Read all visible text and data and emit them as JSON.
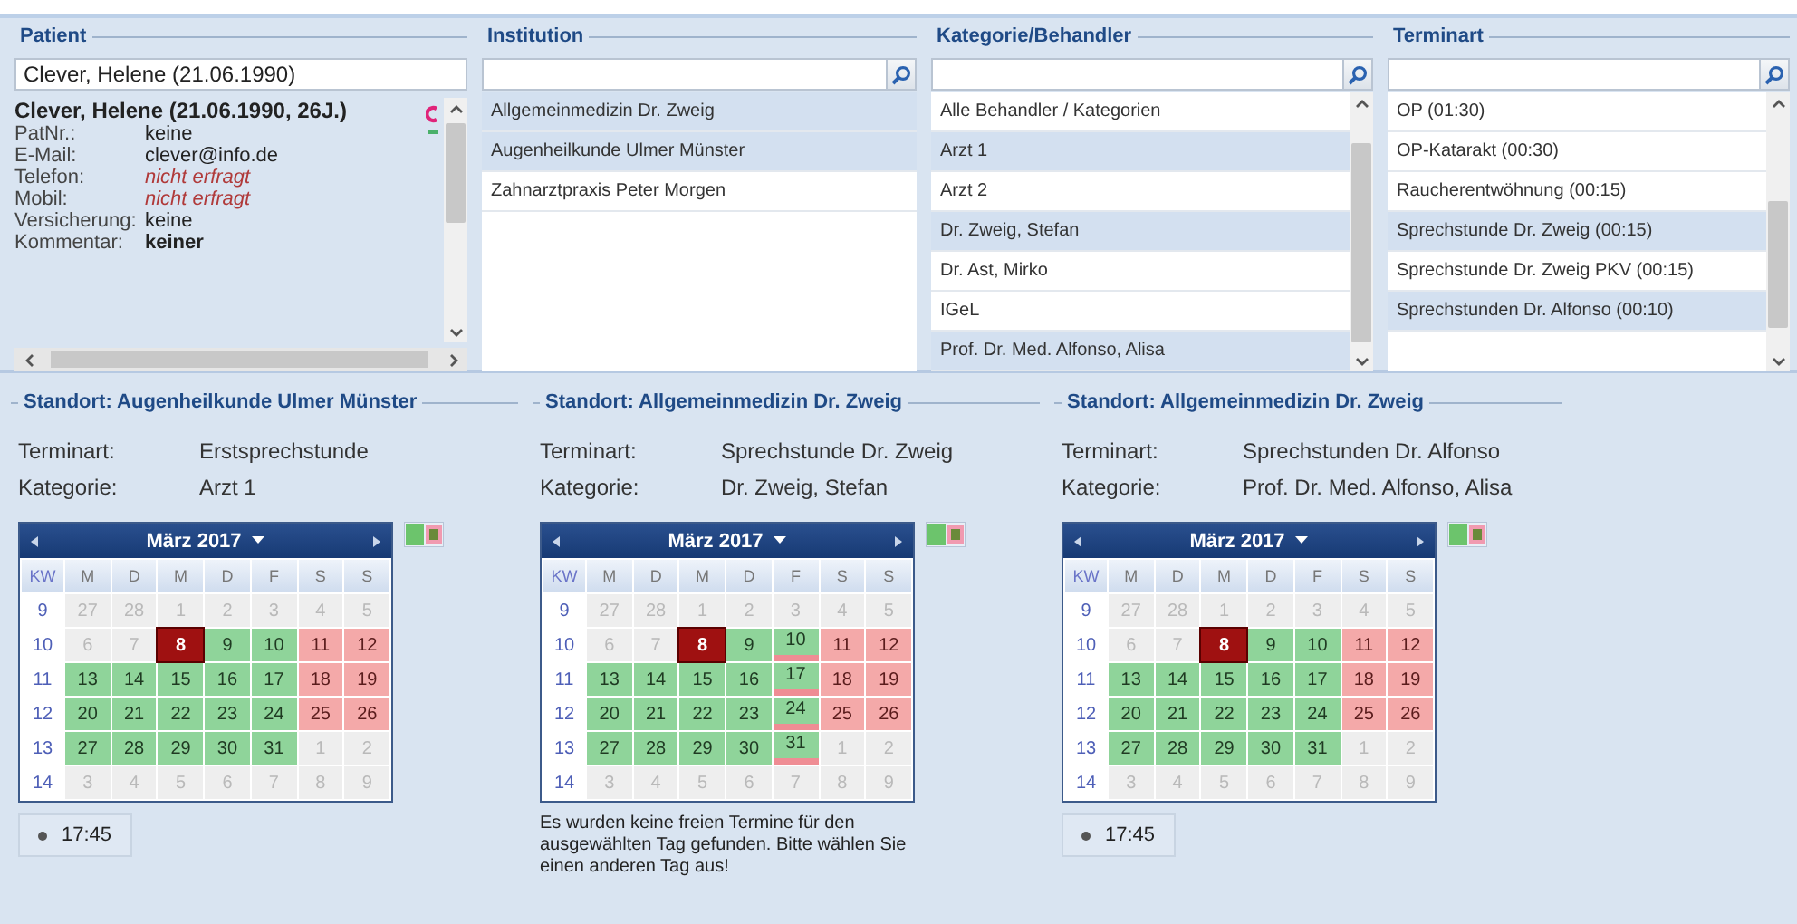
{
  "patient": {
    "title": "Patient",
    "search_value": "Clever, Helene (21.06.1990)",
    "name": "Clever, Helene (21.06.1990, 26J.)",
    "fields": [
      {
        "label": "PatNr.:",
        "value": "keine",
        "kind": "plain"
      },
      {
        "label": "E-Mail:",
        "value": "clever@info.de",
        "kind": "plain"
      },
      {
        "label": "Telefon:",
        "value": "nicht erfragt",
        "kind": "missing"
      },
      {
        "label": "Mobil:",
        "value": "nicht erfragt",
        "kind": "missing"
      },
      {
        "label": "Versicherung:",
        "value": "keine",
        "kind": "plain"
      },
      {
        "label": "Kommentar:",
        "value": "keiner",
        "kind": "bold"
      }
    ]
  },
  "institution": {
    "title": "Institution",
    "items": [
      {
        "label": "Allgemeinmedizin Dr. Zweig",
        "selected": true
      },
      {
        "label": "Augenheilkunde Ulmer Münster",
        "selected": true
      },
      {
        "label": "Zahnarztpraxis Peter Morgen",
        "selected": false
      }
    ]
  },
  "category": {
    "title": "Kategorie/Behandler",
    "items": [
      {
        "label": "Alle Behandler / Kategorien",
        "selected": false
      },
      {
        "label": "Arzt 1",
        "selected": true
      },
      {
        "label": "Arzt 2",
        "selected": false
      },
      {
        "label": "Dr. Zweig, Stefan",
        "selected": true
      },
      {
        "label": "Dr. Ast, Mirko",
        "selected": false
      },
      {
        "label": "IGeL",
        "selected": false
      },
      {
        "label": "Prof. Dr. Med. Alfonso, Alisa",
        "selected": true
      }
    ]
  },
  "appointment_type": {
    "title": "Terminart",
    "items": [
      {
        "label": "OP (01:30)",
        "selected": false
      },
      {
        "label": "OP-Katarakt (00:30)",
        "selected": false
      },
      {
        "label": "Raucherentwöhnung (00:15)",
        "selected": false
      },
      {
        "label": "Sprechstunde Dr. Zweig (00:15)",
        "selected": true
      },
      {
        "label": "Sprechstunde Dr. Zweig PKV (00:15)",
        "selected": false
      },
      {
        "label": "Sprechstunden Dr. Alfonso (00:10)",
        "selected": true
      }
    ]
  },
  "locations": [
    {
      "title": "Standort: Augenheilkunde Ulmer Münster",
      "terminart_label": "Terminart:",
      "terminart": "Erstsprechstunde",
      "kategorie_label": "Kategorie:",
      "kategorie": "Arzt 1",
      "calendar": {
        "month": "März 2017",
        "headers": [
          "KW",
          "M",
          "D",
          "M",
          "D",
          "F",
          "S",
          "S"
        ],
        "weeks": [
          {
            "kw": "9",
            "days": [
              {
                "d": "27",
                "kind": "other"
              },
              {
                "d": "28",
                "kind": "other"
              },
              {
                "d": "1",
                "kind": "other"
              },
              {
                "d": "2",
                "kind": "other"
              },
              {
                "d": "3",
                "kind": "other"
              },
              {
                "d": "4",
                "kind": "other"
              },
              {
                "d": "5",
                "kind": "other"
              }
            ]
          },
          {
            "kw": "10",
            "days": [
              {
                "d": "6",
                "kind": "other"
              },
              {
                "d": "7",
                "kind": "other"
              },
              {
                "d": "8",
                "kind": "selected"
              },
              {
                "d": "9",
                "kind": "free"
              },
              {
                "d": "10",
                "kind": "free"
              },
              {
                "d": "11",
                "kind": "weekend"
              },
              {
                "d": "12",
                "kind": "weekend"
              }
            ]
          },
          {
            "kw": "11",
            "days": [
              {
                "d": "13",
                "kind": "free"
              },
              {
                "d": "14",
                "kind": "free"
              },
              {
                "d": "15",
                "kind": "free"
              },
              {
                "d": "16",
                "kind": "free"
              },
              {
                "d": "17",
                "kind": "free"
              },
              {
                "d": "18",
                "kind": "weekend"
              },
              {
                "d": "19",
                "kind": "weekend"
              }
            ]
          },
          {
            "kw": "12",
            "days": [
              {
                "d": "20",
                "kind": "free"
              },
              {
                "d": "21",
                "kind": "free"
              },
              {
                "d": "22",
                "kind": "free"
              },
              {
                "d": "23",
                "kind": "free"
              },
              {
                "d": "24",
                "kind": "free"
              },
              {
                "d": "25",
                "kind": "weekend"
              },
              {
                "d": "26",
                "kind": "weekend"
              }
            ]
          },
          {
            "kw": "13",
            "days": [
              {
                "d": "27",
                "kind": "free"
              },
              {
                "d": "28",
                "kind": "free"
              },
              {
                "d": "29",
                "kind": "free"
              },
              {
                "d": "30",
                "kind": "free"
              },
              {
                "d": "31",
                "kind": "free"
              },
              {
                "d": "1",
                "kind": "other"
              },
              {
                "d": "2",
                "kind": "other"
              }
            ]
          },
          {
            "kw": "14",
            "days": [
              {
                "d": "3",
                "kind": "other"
              },
              {
                "d": "4",
                "kind": "other"
              },
              {
                "d": "5",
                "kind": "other"
              },
              {
                "d": "6",
                "kind": "other"
              },
              {
                "d": "7",
                "kind": "other"
              },
              {
                "d": "8",
                "kind": "other"
              },
              {
                "d": "9",
                "kind": "other"
              }
            ]
          }
        ]
      },
      "times": [
        "17:45"
      ]
    },
    {
      "title": "Standort: Allgemeinmedizin Dr. Zweig",
      "terminart_label": "Terminart:",
      "terminart": "Sprechstunde Dr. Zweig",
      "kategorie_label": "Kategorie:",
      "kategorie": "Dr.  Zweig, Stefan",
      "calendar": {
        "month": "März 2017",
        "headers": [
          "KW",
          "M",
          "D",
          "M",
          "D",
          "F",
          "S",
          "S"
        ],
        "weeks": [
          {
            "kw": "9",
            "days": [
              {
                "d": "27",
                "kind": "other"
              },
              {
                "d": "28",
                "kind": "other"
              },
              {
                "d": "1",
                "kind": "other"
              },
              {
                "d": "2",
                "kind": "other"
              },
              {
                "d": "3",
                "kind": "other"
              },
              {
                "d": "4",
                "kind": "other"
              },
              {
                "d": "5",
                "kind": "other"
              }
            ]
          },
          {
            "kw": "10",
            "days": [
              {
                "d": "6",
                "kind": "other"
              },
              {
                "d": "7",
                "kind": "other"
              },
              {
                "d": "8",
                "kind": "selected"
              },
              {
                "d": "9",
                "kind": "free"
              },
              {
                "d": "10",
                "kind": "partial"
              },
              {
                "d": "11",
                "kind": "weekend"
              },
              {
                "d": "12",
                "kind": "weekend"
              }
            ]
          },
          {
            "kw": "11",
            "days": [
              {
                "d": "13",
                "kind": "free"
              },
              {
                "d": "14",
                "kind": "free"
              },
              {
                "d": "15",
                "kind": "free"
              },
              {
                "d": "16",
                "kind": "free"
              },
              {
                "d": "17",
                "kind": "partial"
              },
              {
                "d": "18",
                "kind": "weekend"
              },
              {
                "d": "19",
                "kind": "weekend"
              }
            ]
          },
          {
            "kw": "12",
            "days": [
              {
                "d": "20",
                "kind": "free"
              },
              {
                "d": "21",
                "kind": "free"
              },
              {
                "d": "22",
                "kind": "free"
              },
              {
                "d": "23",
                "kind": "free"
              },
              {
                "d": "24",
                "kind": "partial"
              },
              {
                "d": "25",
                "kind": "weekend"
              },
              {
                "d": "26",
                "kind": "weekend"
              }
            ]
          },
          {
            "kw": "13",
            "days": [
              {
                "d": "27",
                "kind": "free"
              },
              {
                "d": "28",
                "kind": "free"
              },
              {
                "d": "29",
                "kind": "free"
              },
              {
                "d": "30",
                "kind": "free"
              },
              {
                "d": "31",
                "kind": "partial"
              },
              {
                "d": "1",
                "kind": "other"
              },
              {
                "d": "2",
                "kind": "other"
              }
            ]
          },
          {
            "kw": "14",
            "days": [
              {
                "d": "3",
                "kind": "other"
              },
              {
                "d": "4",
                "kind": "other"
              },
              {
                "d": "5",
                "kind": "other"
              },
              {
                "d": "6",
                "kind": "other"
              },
              {
                "d": "7",
                "kind": "other"
              },
              {
                "d": "8",
                "kind": "other"
              },
              {
                "d": "9",
                "kind": "other"
              }
            ]
          }
        ]
      },
      "message": "Es wurden keine freien Termine für den ausgewählten Tag gefunden. Bitte wählen Sie einen anderen Tag aus!"
    },
    {
      "title": "Standort: Allgemeinmedizin Dr. Zweig",
      "terminart_label": "Terminart:",
      "terminart": "Sprechstunden Dr. Alfonso",
      "kategorie_label": "Kategorie:",
      "kategorie": "Prof. Dr. Med. Alfonso, Alisa",
      "calendar": {
        "month": "März 2017",
        "headers": [
          "KW",
          "M",
          "D",
          "M",
          "D",
          "F",
          "S",
          "S"
        ],
        "weeks": [
          {
            "kw": "9",
            "days": [
              {
                "d": "27",
                "kind": "other"
              },
              {
                "d": "28",
                "kind": "other"
              },
              {
                "d": "1",
                "kind": "other"
              },
              {
                "d": "2",
                "kind": "other"
              },
              {
                "d": "3",
                "kind": "other"
              },
              {
                "d": "4",
                "kind": "other"
              },
              {
                "d": "5",
                "kind": "other"
              }
            ]
          },
          {
            "kw": "10",
            "days": [
              {
                "d": "6",
                "kind": "other"
              },
              {
                "d": "7",
                "kind": "other"
              },
              {
                "d": "8",
                "kind": "selected"
              },
              {
                "d": "9",
                "kind": "free"
              },
              {
                "d": "10",
                "kind": "free"
              },
              {
                "d": "11",
                "kind": "weekend"
              },
              {
                "d": "12",
                "kind": "weekend"
              }
            ]
          },
          {
            "kw": "11",
            "days": [
              {
                "d": "13",
                "kind": "free"
              },
              {
                "d": "14",
                "kind": "free"
              },
              {
                "d": "15",
                "kind": "free"
              },
              {
                "d": "16",
                "kind": "free"
              },
              {
                "d": "17",
                "kind": "free"
              },
              {
                "d": "18",
                "kind": "weekend"
              },
              {
                "d": "19",
                "kind": "weekend"
              }
            ]
          },
          {
            "kw": "12",
            "days": [
              {
                "d": "20",
                "kind": "free"
              },
              {
                "d": "21",
                "kind": "free"
              },
              {
                "d": "22",
                "kind": "free"
              },
              {
                "d": "23",
                "kind": "free"
              },
              {
                "d": "24",
                "kind": "free"
              },
              {
                "d": "25",
                "kind": "weekend"
              },
              {
                "d": "26",
                "kind": "weekend"
              }
            ]
          },
          {
            "kw": "13",
            "days": [
              {
                "d": "27",
                "kind": "free"
              },
              {
                "d": "28",
                "kind": "free"
              },
              {
                "d": "29",
                "kind": "free"
              },
              {
                "d": "30",
                "kind": "free"
              },
              {
                "d": "31",
                "kind": "free"
              },
              {
                "d": "1",
                "kind": "other"
              },
              {
                "d": "2",
                "kind": "other"
              }
            ]
          },
          {
            "kw": "14",
            "days": [
              {
                "d": "3",
                "kind": "other"
              },
              {
                "d": "4",
                "kind": "other"
              },
              {
                "d": "5",
                "kind": "other"
              },
              {
                "d": "6",
                "kind": "other"
              },
              {
                "d": "7",
                "kind": "other"
              },
              {
                "d": "8",
                "kind": "other"
              },
              {
                "d": "9",
                "kind": "other"
              }
            ]
          }
        ]
      },
      "times": [
        "17:45"
      ]
    }
  ]
}
